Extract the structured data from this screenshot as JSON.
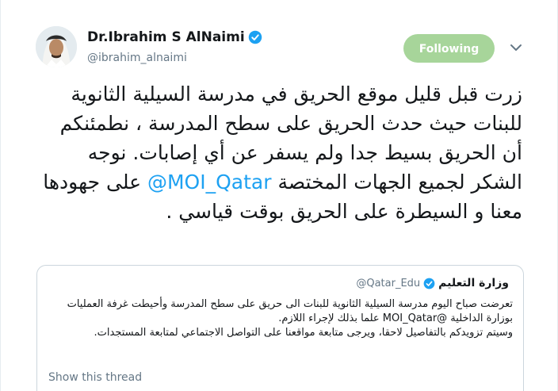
{
  "author": {
    "name": "Dr.Ibrahim S AlNaimi",
    "handle": "@ibrahim_alnaimi",
    "verified": true
  },
  "follow_button": {
    "label": "Following",
    "color": "#a7d59a"
  },
  "menu_icon": "chevron-down-icon",
  "tweet": {
    "text_part1": "زرت قبل قليل موقع الحريق في مدرسة السيلية الثانوية للبنات حيث حدث الحريق على سطح المدرسة ، نطمئنكم أن الحريق بسيط جدا ولم يسفر عن أي إصابات. نوجه الشكر لجميع الجهات المختصة",
    "mention": "@MOI_Qatar",
    "text_part2": "على جهودها معنا و السيطرة على الحريق بوقت قياسي ."
  },
  "quoted_tweet": {
    "name": "وزارة التعليم",
    "handle": "@Qatar_Edu",
    "verified": true,
    "line1": "تعرضت صباح اليوم مدرسة السيلية الثانوية للبنات الى حريق على سطح المدرسة وأحيطت غرفة العمليات بوزارة الداخلية @MOI_Qatar علما بذلك لإجراء اللازم.",
    "line2": "وسيتم تزويدكم بالتفاصيل لاحقا، ويرجى متابعة مواقعنا على التواصل الاجتماعي لمتابعة المستجدات.",
    "show_thread": "Show this thread"
  },
  "colors": {
    "link": "#1da1f2",
    "secondary_text": "#657786",
    "border": "#ccd6dd",
    "verified": "#1da1f2"
  }
}
